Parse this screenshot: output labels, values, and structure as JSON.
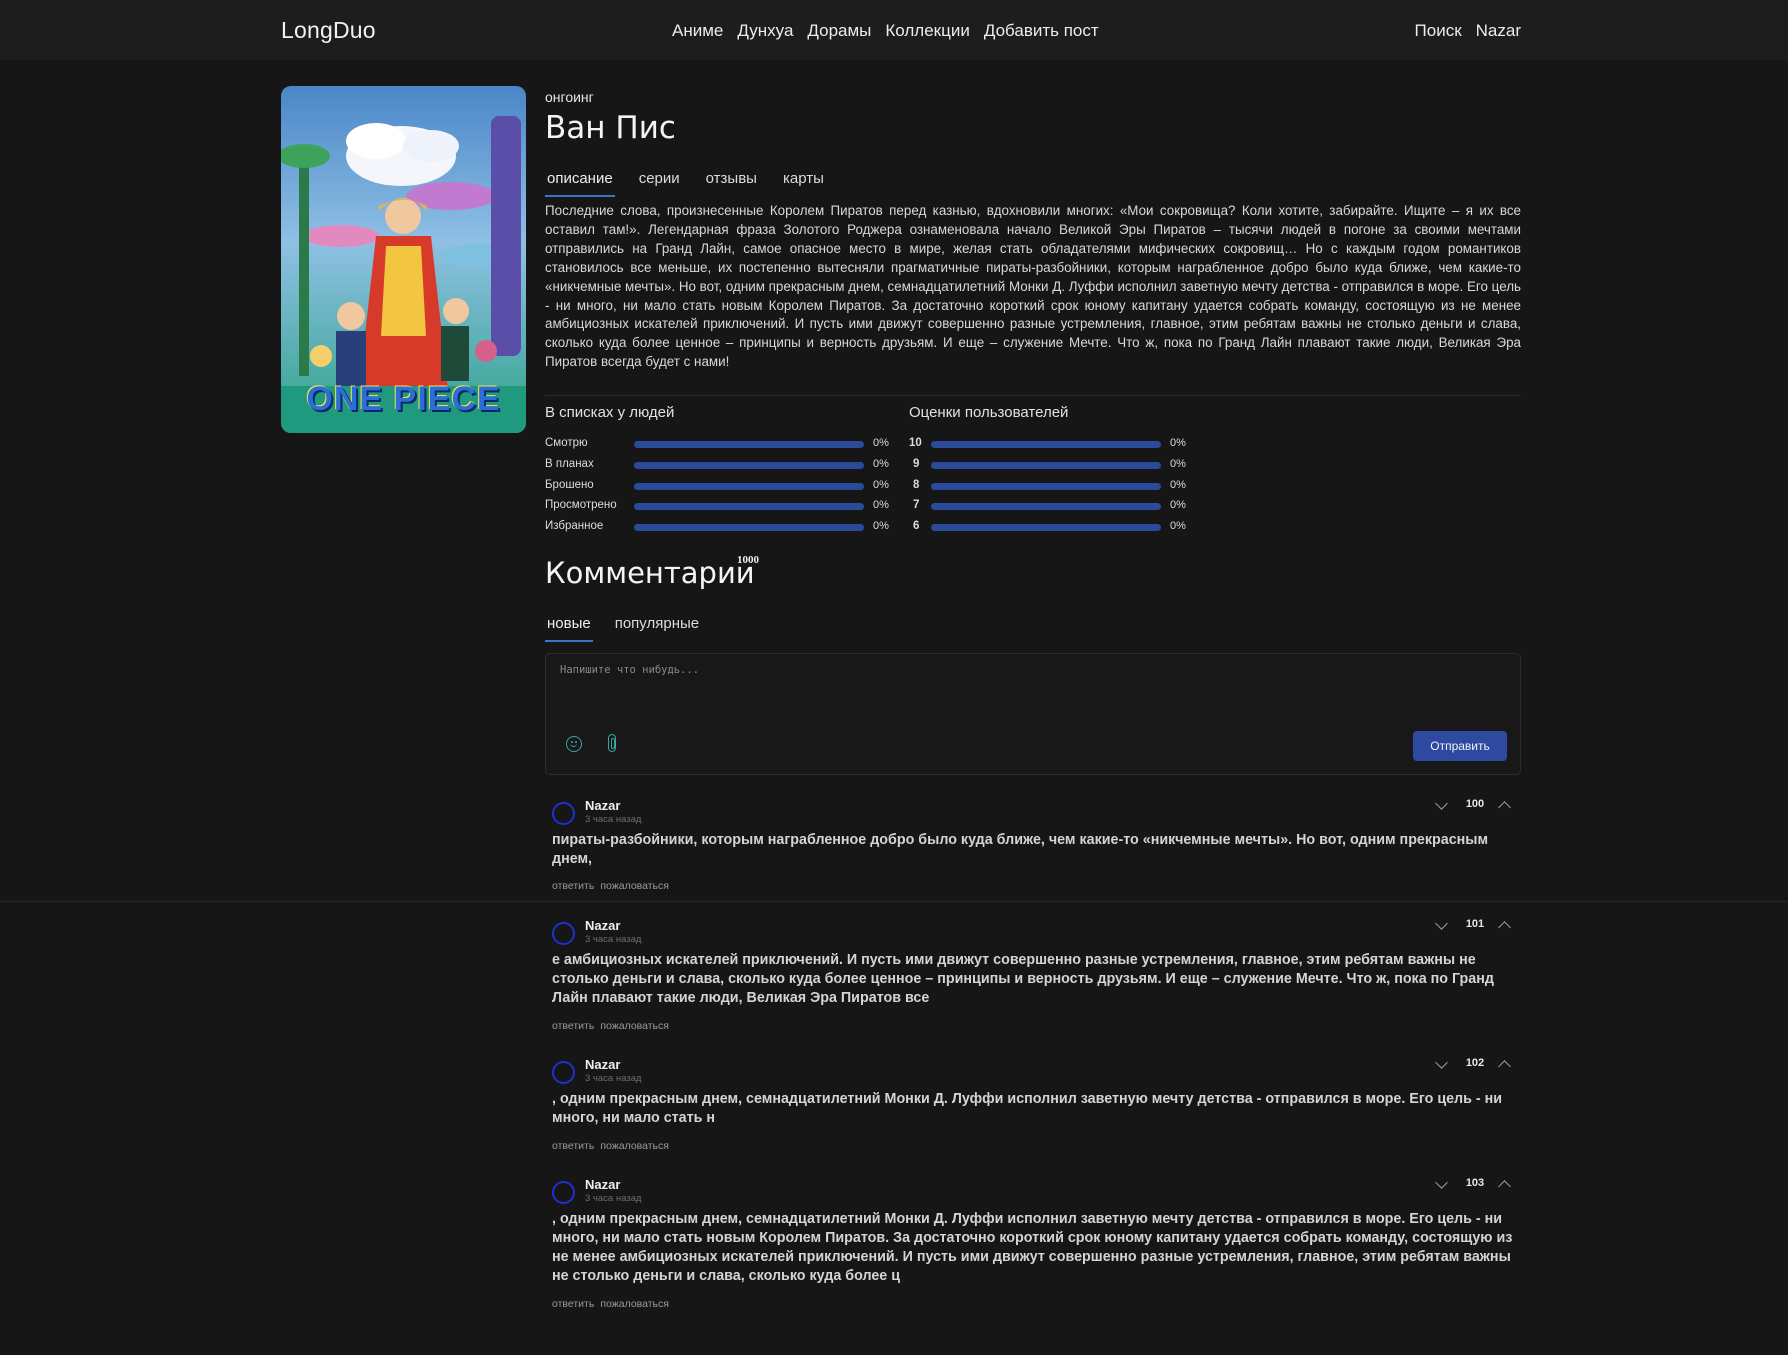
{
  "nav": {
    "logo": "LongDuo",
    "links": [
      "Аниме",
      "Дунхуа",
      "Дорамы",
      "Коллекции",
      "Добавить пост"
    ],
    "search": "Поиск",
    "user": "Nazar"
  },
  "anime": {
    "status": "онгоинг",
    "title": "Ван Пис",
    "poster_logo": "ONE PIECE",
    "tabs": [
      "описание",
      "серии",
      "отзывы",
      "карты"
    ],
    "active_tab": "описание",
    "description": "Последние слова, произнесенные Королем Пиратов перед казнью, вдохновили многих: «Мои сокровища? Коли хотите, забирайте. Ищите – я их все оставил там!». Легендарная фраза Золотого Роджера ознаменовала начало Великой Эры Пиратов – тысячи людей в погоне за своими мечтами отправились на Гранд Лайн, самое опасное место в мире, желая стать обладателями мифических сокровищ… Но с каждым годом романтиков становилось все меньше, их постепенно вытесняли прагматичные пираты-разбойники, которым награбленное добро было куда ближе, чем какие-то «никчемные мечты». Но вот, одним прекрасным днем, семнадцатилетний Монки Д. Луффи исполнил заветную мечту детства - отправился в море. Его цель - ни много, ни мало стать новым Королем Пиратов. За достаточно короткий срок юному капитану удается собрать команду, состоящую из не менее амбициозных искателей приключений. И пусть ими движут совершенно разные устремления, главное, этим ребятам важны не столько деньги и слава, сколько куда более ценное – принципы и верность друзьям. И еще – служение Мечте. Что ж, пока по Гранд Лайн плавают такие люди, Великая Эра Пиратов всегда будет с нами!"
  },
  "lists": {
    "title": "В списках у людей",
    "rows": [
      {
        "label": "Смотрю",
        "pct": "0%"
      },
      {
        "label": "В планах",
        "pct": "0%"
      },
      {
        "label": "Брошено",
        "pct": "0%"
      },
      {
        "label": "Просмотрено",
        "pct": "0%"
      },
      {
        "label": "Избранное",
        "pct": "0%"
      }
    ]
  },
  "ratings": {
    "title": "Оценки пользователей",
    "rows": [
      {
        "label": "10",
        "pct": "0%"
      },
      {
        "label": "9",
        "pct": "0%"
      },
      {
        "label": "8",
        "pct": "0%"
      },
      {
        "label": "7",
        "pct": "0%"
      },
      {
        "label": "6",
        "pct": "0%"
      }
    ]
  },
  "comments": {
    "title": "Комментарии",
    "count": "1000",
    "tabs": [
      "новые",
      "популярные"
    ],
    "active_tab": "новые",
    "placeholder": "Напишите что нибудь...",
    "send_label": "Отправить",
    "items": [
      {
        "author": "Nazar",
        "time": "3 часа назад",
        "score": "100",
        "text": "пираты-разбойники, которым награбленное добро было куда ближе, чем какие-то «никчемные мечты». Но вот, одним прекрасным днем,",
        "reply": "ответить",
        "report": "пожаловаться"
      },
      {
        "author": "Nazar",
        "time": "3 часа назад",
        "score": "101",
        "text": "е амбициозных искателей приключений. И пусть ими движут совершенно разные устремления, главное, этим ребятам важны не столько деньги и слава, сколько куда более ценное – принципы и верность друзьям. И еще – служение Мечте. Что ж, пока по Гранд Лайн плавают такие люди, Великая Эра Пиратов все",
        "reply": "ответить",
        "report": "пожаловаться"
      },
      {
        "author": "Nazar",
        "time": "3 часа назад",
        "score": "102",
        "text": ", одним прекрасным днем, семнадцатилетний Монки Д. Луффи исполнил заветную мечту детства - отправился в море. Его цель - ни много, ни мало стать н",
        "reply": "ответить",
        "report": "пожаловаться"
      },
      {
        "author": "Nazar",
        "time": "3 часа назад",
        "score": "103",
        "text": ", одним прекрасным днем, семнадцатилетний Монки Д. Луффи исполнил заветную мечту детства - отправился в море. Его цель - ни много, ни мало стать новым Королем Пиратов. За достаточно короткий срок юному капитану удается собрать команду, состоящую из не менее амбициозных искателей приключений. И пусть ими движут совершенно разные устремления, главное, этим ребятам важны не столько деньги и слава, сколько куда более ц",
        "reply": "ответить",
        "report": "пожаловаться"
      }
    ]
  },
  "colors": {
    "background": "#161616",
    "navbar": "#1d1d1d",
    "accent": "#2e4aa0",
    "bar": "#2b4a9a",
    "avatar_ring": "#1f2fd0",
    "icon": "#3aa7a0"
  },
  "icons": [
    "emoji-icon",
    "paperclip-icon",
    "chevron-down-icon",
    "chevron-up-icon",
    "avatar-icon"
  ]
}
